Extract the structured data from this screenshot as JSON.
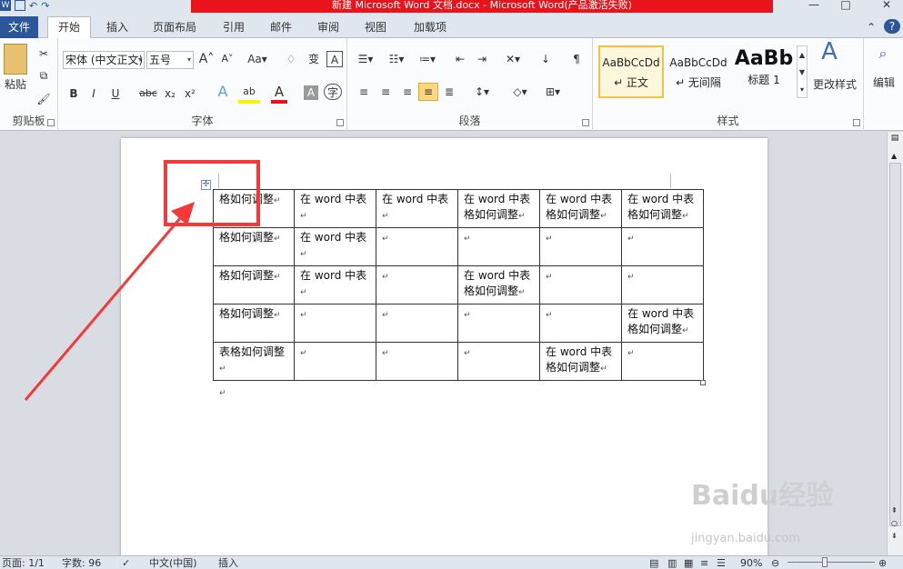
{
  "window": {
    "title": "新建 Microsoft Word 文档.docx - Microsoft Word(产品激活失败)",
    "controls": [
      "—",
      "□",
      "✕"
    ]
  },
  "tabs": [
    "文件",
    "开始",
    "插入",
    "页面布局",
    "引用",
    "邮件",
    "审阅",
    "视图",
    "加载项"
  ],
  "ribbon": {
    "clipboard": {
      "paste": "粘贴",
      "label": "剪贴板"
    },
    "font": {
      "name": "宋体 (中文正文)",
      "size": "五号",
      "label": "字体",
      "bold": "B",
      "italic": "I",
      "underline": "U",
      "strike": "abc",
      "sub": "x₂",
      "sup": "x²"
    },
    "paragraph": {
      "label": "段落"
    },
    "styles": {
      "label": "样式",
      "items": [
        {
          "preview": "AaBbCcDd",
          "name": "↵ 正文"
        },
        {
          "preview": "AaBbCcDd",
          "name": "↵ 无间隔"
        },
        {
          "preview": "AaBb",
          "name": "标题 1"
        }
      ],
      "change": "更改样式"
    },
    "editing": {
      "label": "编辑"
    }
  },
  "table": {
    "rows": [
      [
        "格如何调整",
        "在 word 中表",
        "在 word 中表",
        "在 word 中表格如何调整",
        "在 word 中表格如何调整",
        "在 word 中表格如何调整"
      ],
      [
        "格如何调整",
        "在 word 中表",
        "",
        "",
        "",
        ""
      ],
      [
        "格如何调整",
        "在 word 中表",
        "",
        "在 word 中表格如何调整",
        "",
        ""
      ],
      [
        "格如何调整",
        "",
        "",
        "",
        "",
        "在 word 中表格如何调整"
      ],
      [
        "表格如何调整",
        "",
        "",
        "",
        "在 word 中表格如何调整",
        ""
      ]
    ]
  },
  "status": {
    "page": "页面: 1/1",
    "words": "字数: 96",
    "lang": "中文(中国)",
    "mode": "插入",
    "zoom": "90%"
  },
  "watermark": {
    "main": "Baidu经验",
    "sub": "jingyan.baidu.com"
  },
  "colors": {
    "accent": "#2b579a",
    "title_red": "#e8131b",
    "annotation": "#f23a3a"
  }
}
